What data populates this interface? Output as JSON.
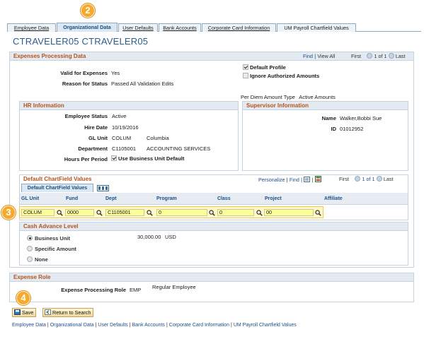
{
  "tabs": [
    {
      "label": "Employee Data"
    },
    {
      "label": "Organizational Data"
    },
    {
      "label": "User Defaults"
    },
    {
      "label": "Bank Accounts"
    },
    {
      "label": "Corporate Card Information"
    },
    {
      "label": "UM Payroll Chartfield Values"
    }
  ],
  "badges": [
    "2",
    "3",
    "4"
  ],
  "page_title": "CTRAVELER05 CTRAVELER05",
  "expenses": {
    "header": "Expenses Processing Data",
    "nav_find": "Find",
    "nav_sep": "|",
    "nav_view_all": "View All",
    "nav_first": "First",
    "nav_count": "1 of 1",
    "nav_last": "Last",
    "valid_label": "Valid for Expenses",
    "valid_value": "Yes",
    "reason_label": "Reason for Status",
    "reason_value": "Passed All Validation Edits",
    "default_profile": "Default Profile",
    "ignore_amounts": "Ignore Authorized Amounts",
    "per_diem_label": "Per Diem Amount Type",
    "per_diem_value": "Active Amounts"
  },
  "hr": {
    "header": "HR Information",
    "status_label": "Employee Status",
    "status_value": "Active",
    "hire_label": "Hire Date",
    "hire_value": "10/19/2016",
    "gl_label": "GL Unit",
    "gl_code": "COLUM",
    "gl_desc": "Columbia",
    "dept_label": "Department",
    "dept_code": "C1105001",
    "dept_desc": "ACCOUNTING SERVICES",
    "hours_label": "Hours Per Period",
    "use_bu_default": "Use Business Unit Default"
  },
  "supervisor": {
    "header": "Supervisor Information",
    "name_label": "Name",
    "name_value": "Walker,Bobbi Sue",
    "id_label": "ID",
    "id_value": "01012952"
  },
  "chartfield": {
    "header": "Default ChartField Values",
    "personalize": "Personalize",
    "find": "Find",
    "first": "First",
    "count": "1 of 1",
    "last": "Last",
    "subtab": "Default ChartField Values",
    "columns": [
      "GL Unit",
      "Fund",
      "Dept",
      "Program",
      "Class",
      "Project",
      "Affiliate"
    ],
    "row": [
      "COLUM",
      "0000",
      "C1105001",
      "0",
      "0",
      "00"
    ]
  },
  "cash_advance": {
    "header": "Cash Advance Level",
    "options": [
      "Business Unit",
      "Specific Amount",
      "None"
    ],
    "amount": "30,000.00",
    "currency": "USD"
  },
  "expense_role": {
    "header": "Expense Role",
    "label": "Expense Processing Role",
    "code": "EMP",
    "desc": "Regular Employee"
  },
  "buttons": {
    "save": "Save",
    "return": "Return to Search"
  },
  "footer_links": [
    "Employee Data",
    "Organizational Data",
    "User Defaults",
    "Bank Accounts",
    "Corporate Card Information",
    "UM Payroll Chartfield Values"
  ],
  "colors": {
    "badge": "#f6a92b",
    "accent": "#b5531b",
    "field": "#ffff99"
  }
}
